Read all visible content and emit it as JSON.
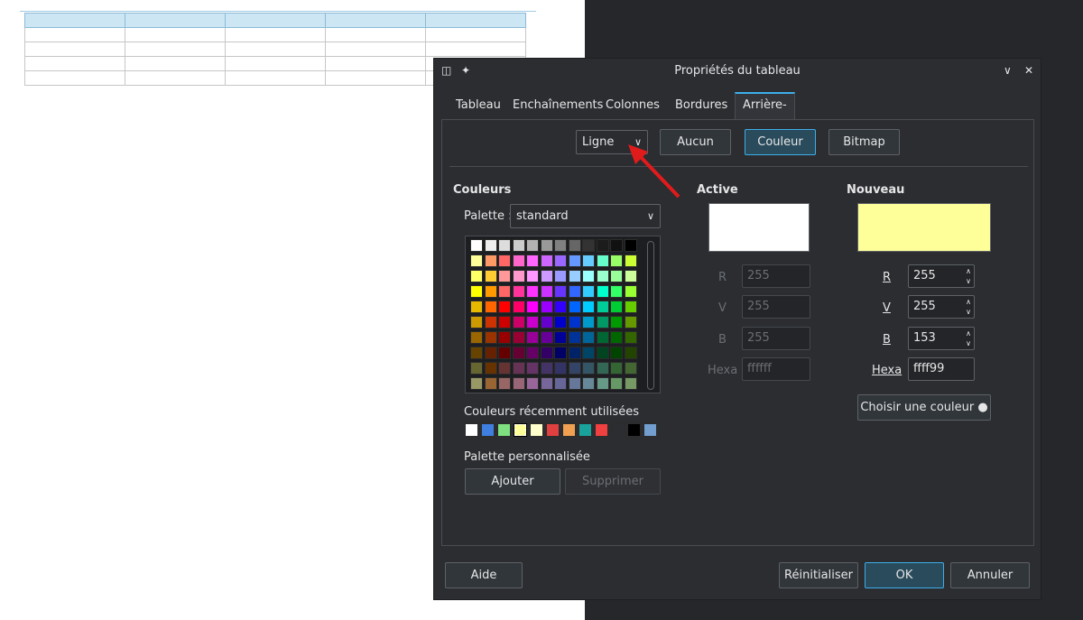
{
  "dialog": {
    "title": "Propriétés du tableau"
  },
  "tabs": [
    {
      "label": "Tableau"
    },
    {
      "label": "Enchaînements"
    },
    {
      "label": "Colonnes"
    },
    {
      "label": "Bordures"
    },
    {
      "label": "Arrière-plan"
    }
  ],
  "active_tab": "Arrière-plan",
  "fill": {
    "type_value": "Ligne",
    "buttons": {
      "none": "Aucun",
      "color": "Couleur",
      "bitmap": "Bitmap"
    }
  },
  "colors": {
    "heading": "Couleurs",
    "palette_label": "Palette :",
    "palette_value": "standard",
    "recent_label": "Couleurs récemment utilisées",
    "custom_label": "Palette personnalisée",
    "add": "Ajouter",
    "remove": "Supprimer",
    "recent": [
      "#ffffff",
      "#3f7fe0",
      "#7fe07f",
      "#ffff99",
      "#ffffcc",
      "#e0403f",
      "#f0a050",
      "#1aa39a",
      "#f04040",
      "#2b2d31",
      "#000000",
      "#729fcf"
    ]
  },
  "active": {
    "heading": "Active",
    "color": "#ffffff",
    "r_label": "R",
    "r": "255",
    "g_label": "V",
    "g": "255",
    "b_label": "B",
    "b": "255",
    "hex_label": "Hexa",
    "hex": "ffffff"
  },
  "new": {
    "heading": "Nouveau",
    "color": "#ffff99",
    "r_label": "R",
    "r": "255",
    "g_label": "V",
    "g": "255",
    "b_label": "B",
    "b": "153",
    "hex_label": "Hexa",
    "hex": "ffff99",
    "picker": "Choisir une couleur"
  },
  "footer": {
    "help": "Aide",
    "reset": "Réinitialiser",
    "ok": "OK",
    "cancel": "Annuler"
  },
  "palette_rows": [
    [
      "#ffffff",
      "#eeeeee",
      "#dddddd",
      "#cccccc",
      "#b2b2b2",
      "#999999",
      "#808080",
      "#666666",
      "#333333",
      "#1c1c1c",
      "#111111",
      "#000000"
    ],
    [
      "#ffff99",
      "#ff9966",
      "#ff6666",
      "#ff66cc",
      "#ff66ff",
      "#cc66ff",
      "#9966ff",
      "#6699ff",
      "#66ccff",
      "#66ffcc",
      "#99ff66",
      "#ccff33"
    ],
    [
      "#ffff66",
      "#ffcc33",
      "#ff9999",
      "#ff99cc",
      "#ff99ff",
      "#cc99ff",
      "#9999ff",
      "#99ccff",
      "#99ffff",
      "#99ffcc",
      "#99ff99",
      "#ccff99"
    ],
    [
      "#ffff00",
      "#ff9900",
      "#ff6666",
      "#ff3399",
      "#ff33ff",
      "#cc33ff",
      "#6633ff",
      "#3366ff",
      "#33ccff",
      "#00ffcc",
      "#33ff66",
      "#99ff33"
    ],
    [
      "#e6b800",
      "#ff6600",
      "#ff0000",
      "#ff0066",
      "#ff00ff",
      "#9900ff",
      "#3300ff",
      "#0066ff",
      "#00ccff",
      "#00cc99",
      "#00cc33",
      "#66cc00"
    ],
    [
      "#cc9900",
      "#cc3300",
      "#cc0000",
      "#cc0066",
      "#cc00cc",
      "#6600cc",
      "#0000cc",
      "#0033cc",
      "#0099cc",
      "#009966",
      "#009900",
      "#669900"
    ],
    [
      "#996600",
      "#993300",
      "#990000",
      "#990033",
      "#990099",
      "#660099",
      "#000099",
      "#003399",
      "#006699",
      "#006633",
      "#006600",
      "#336600"
    ],
    [
      "#664400",
      "#662200",
      "#660000",
      "#660033",
      "#660066",
      "#330066",
      "#000066",
      "#002266",
      "#004466",
      "#004422",
      "#004400",
      "#224400"
    ],
    [
      "#666633",
      "#663300",
      "#663333",
      "#663355",
      "#663366",
      "#443366",
      "#333366",
      "#334466",
      "#335566",
      "#336655",
      "#336633",
      "#446633"
    ],
    [
      "#999966",
      "#996633",
      "#996666",
      "#996677",
      "#996699",
      "#776699",
      "#666699",
      "#667799",
      "#668899",
      "#669988",
      "#669966",
      "#779966"
    ]
  ]
}
